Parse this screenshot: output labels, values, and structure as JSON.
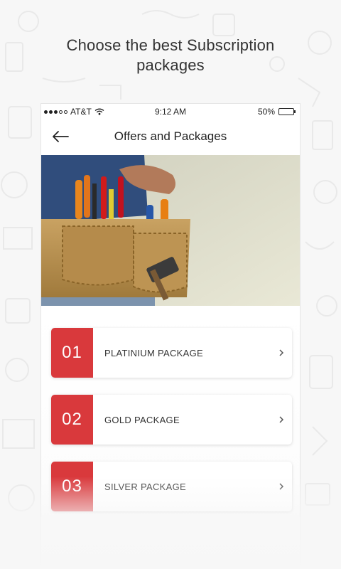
{
  "headline": {
    "line1": "Choose the best Subscription",
    "line2": "packages"
  },
  "status_bar": {
    "carrier": "AT&T",
    "time": "9:12 AM",
    "battery": "50%"
  },
  "nav": {
    "title": "Offers and Packages",
    "back_icon": "arrow-left-icon"
  },
  "colors": {
    "accent_red": "#d9393c"
  },
  "packages": [
    {
      "number": "01",
      "label": "PLATINIUM PACKAGE"
    },
    {
      "number": "02",
      "label": "GOLD PACKAGE"
    },
    {
      "number": "03",
      "label": "SILVER PACKAGE"
    }
  ]
}
